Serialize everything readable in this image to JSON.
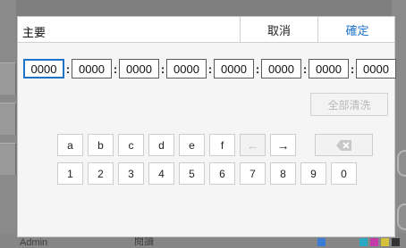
{
  "dialog": {
    "title": "主要",
    "cancel_label": "取消",
    "ok_label": "確定",
    "clear_label": "全部清洗"
  },
  "address": {
    "fields": [
      "0000",
      "0000",
      "0000",
      "0000",
      "0000",
      "0000",
      "0000",
      "0000"
    ],
    "separator": ":"
  },
  "keypad": {
    "row1": [
      "a",
      "b",
      "c",
      "d",
      "e",
      "f"
    ],
    "left_arrow": "←",
    "right_arrow": "→",
    "backspace_icon": "backspace-icon",
    "row2": [
      "1",
      "2",
      "3",
      "4",
      "5",
      "6",
      "7",
      "8",
      "9",
      "0"
    ]
  },
  "background": {
    "bottom_left_text": "Admin",
    "bottom_mid_text": "閱讀"
  },
  "colors": {
    "accent": "#1e73c8",
    "disabled_text": "#b8b8b8"
  }
}
